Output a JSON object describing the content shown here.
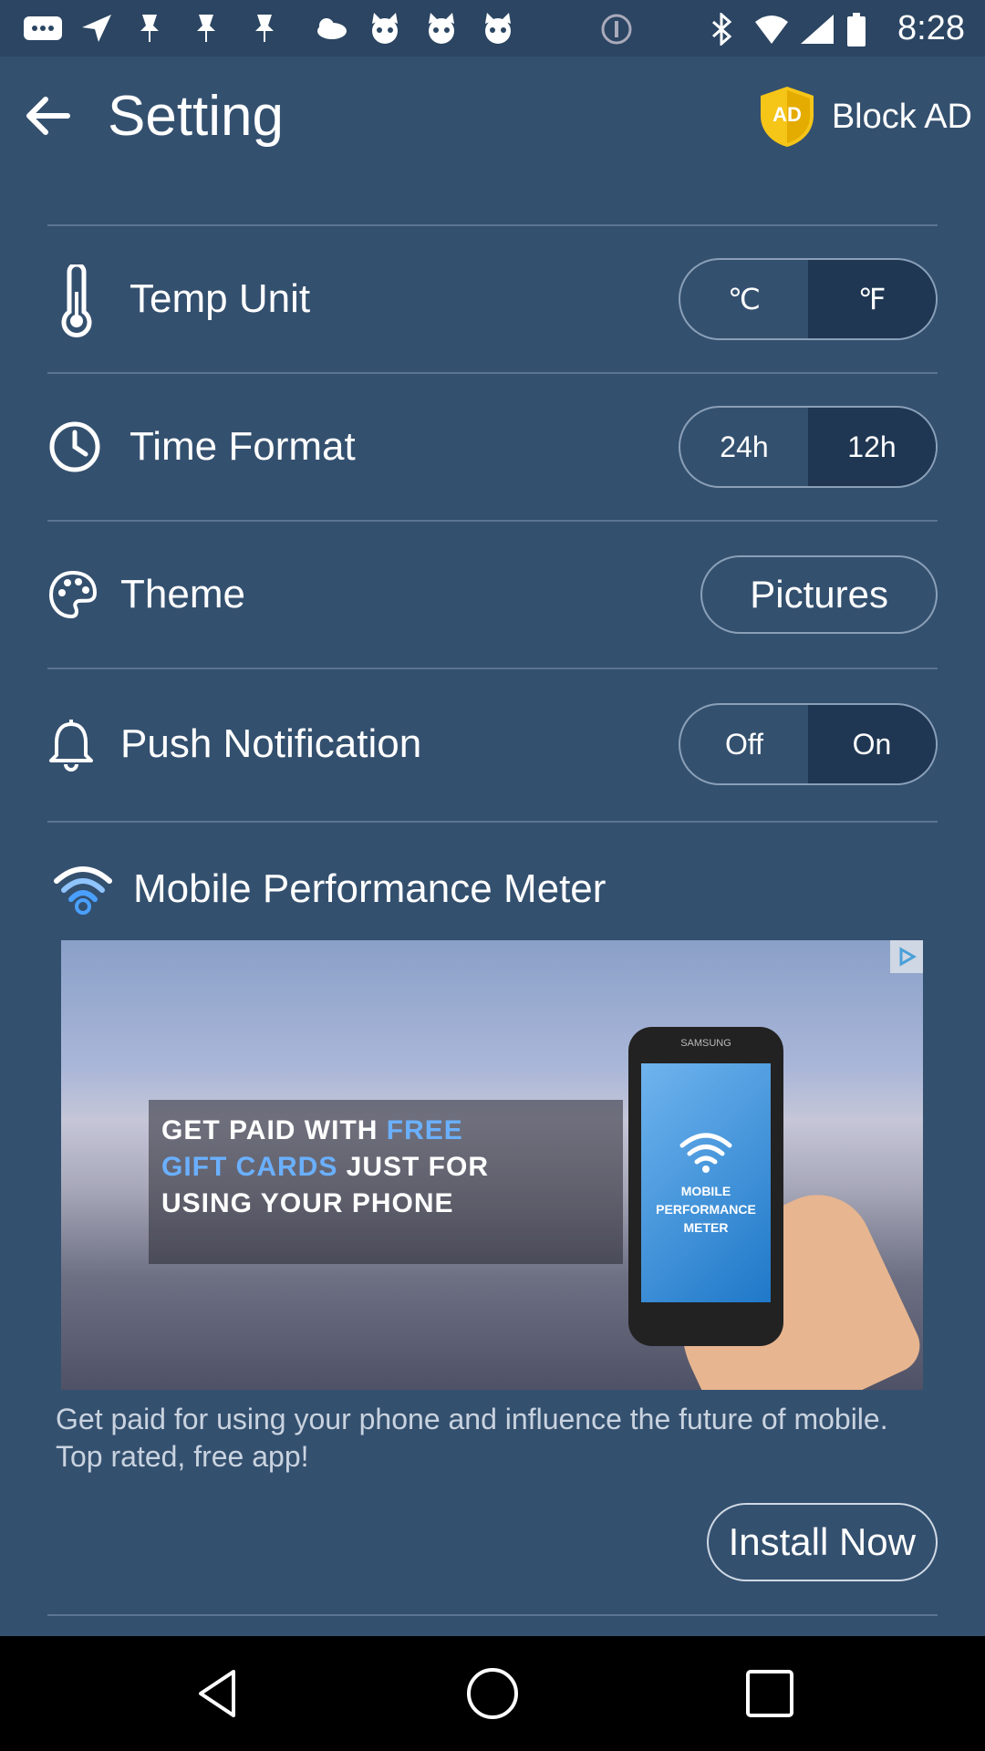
{
  "status_bar": {
    "time": "8:28"
  },
  "header": {
    "title": "Setting",
    "block_ad_badge": "AD",
    "block_ad_label": "Block AD"
  },
  "settings": [
    {
      "label": "Temp Unit",
      "icon": "thermometer-icon",
      "options": [
        "℃",
        "℉"
      ],
      "selected": "℉"
    },
    {
      "label": "Time Format",
      "icon": "clock-icon",
      "options": [
        "24h",
        "12h"
      ],
      "selected": "12h"
    },
    {
      "label": "Theme",
      "icon": "palette-icon",
      "value": "Pictures"
    },
    {
      "label": "Push Notification",
      "icon": "bell-icon",
      "options": [
        "Off",
        "On"
      ],
      "selected": "On"
    }
  ],
  "ad": {
    "title": "Mobile Performance Meter",
    "image_headline": [
      "GET PAID WITH ",
      "FREE",
      "GIFT CARDS",
      " JUST FOR",
      "USING YOUR PHONE"
    ],
    "phone_brand": "SAMSUNG",
    "phone_caption": "MOBILE PERFORMANCE METER",
    "description": "Get paid for using your phone and influence the future of mobile. Top rated, free app!",
    "cta": "Install Now"
  },
  "colors": {
    "background": "#34506f",
    "selected_segment": "#1f3753",
    "accent_shield": "#f5c518"
  }
}
